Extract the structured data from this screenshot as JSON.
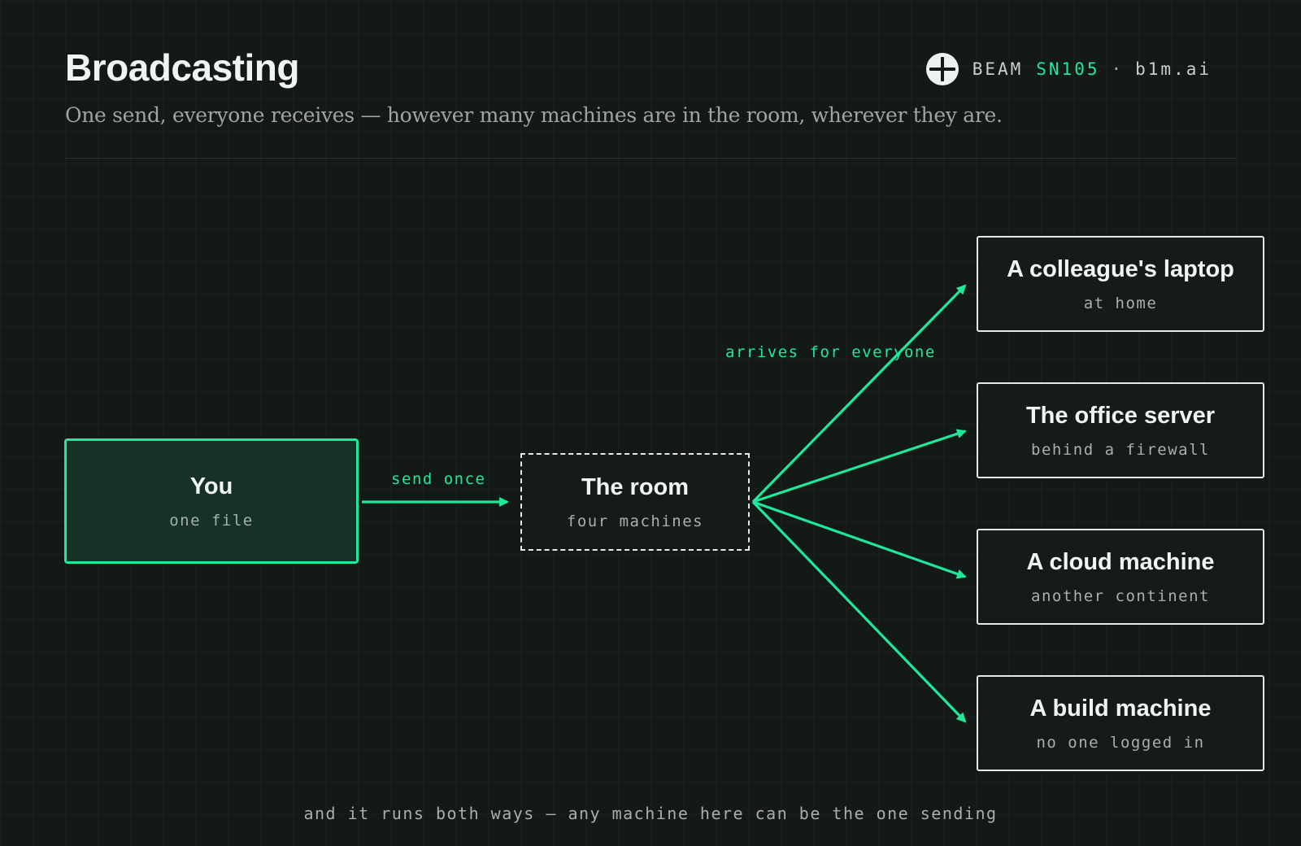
{
  "header": {
    "title": "Broadcasting",
    "subtitle": "One send, everyone receives — however many machines are in the room, wherever they are."
  },
  "brand": {
    "icon": "plus-in-circle-icon",
    "name": "BEAM",
    "code": "SN105",
    "separator": "·",
    "site": "b1m.ai",
    "accent_color": "#1ee89a"
  },
  "diagram": {
    "source": {
      "title": "You",
      "subtitle": "one file"
    },
    "hub": {
      "title": "The room",
      "subtitle": "four machines"
    },
    "destinations": [
      {
        "title": "A colleague's laptop",
        "subtitle": "at home"
      },
      {
        "title": "The office server",
        "subtitle": "behind a firewall"
      },
      {
        "title": "A cloud machine",
        "subtitle": "another continent"
      },
      {
        "title": "A build machine",
        "subtitle": "no one logged in"
      }
    ],
    "edge_labels": {
      "send": "send once",
      "arrives": "arrives for everyone"
    }
  },
  "footer": {
    "note": "and it runs both ways — any machine here can be the one sending"
  },
  "colors": {
    "background": "#131916",
    "accent": "#1ee89a",
    "source_fill": "#163126",
    "box_border": "#e6e9e7"
  }
}
